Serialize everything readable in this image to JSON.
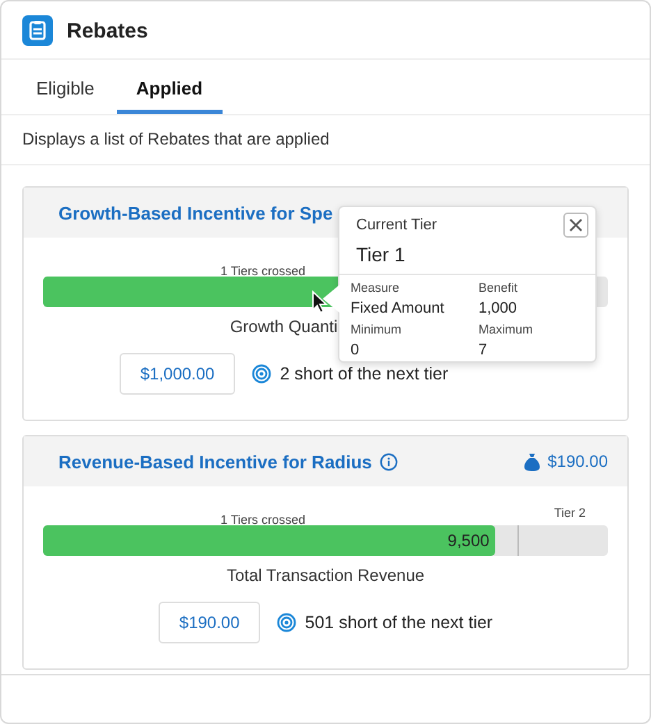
{
  "app": {
    "title": "Rebates"
  },
  "tabs": [
    {
      "label": "Eligible",
      "selected": false
    },
    {
      "label": "Applied",
      "selected": true
    }
  ],
  "description": "Displays a list of Rebates that are applied",
  "rebates": [
    {
      "title": "Growth-Based Incentive for Spe",
      "tiers_crossed": "1 Tiers crossed",
      "level": 0.8,
      "measure": "Growth Quanti",
      "payout": "$1,000.00",
      "shortfall": "2 short of the next tier",
      "popover": {
        "heading": "Current Tier",
        "tier": "Tier 1",
        "fields": [
          {
            "label": "Measure",
            "value": "Fixed Amount"
          },
          {
            "label": "Benefit",
            "value": "1,000"
          },
          {
            "label": "Minimum",
            "value": "0"
          },
          {
            "label": "Maximum",
            "value": "7"
          }
        ]
      }
    },
    {
      "title": "Revenue-Based Incentive for Radius",
      "info": true,
      "amount": "$190.00",
      "tiers_crossed": "1 Tiers crossed",
      "next_tier": "Tier 2",
      "value": "9,500",
      "level": 0.8,
      "measure": "Total Transaction Revenue",
      "payout": "$190.00",
      "shortfall": "501 short of the next tier"
    }
  ]
}
